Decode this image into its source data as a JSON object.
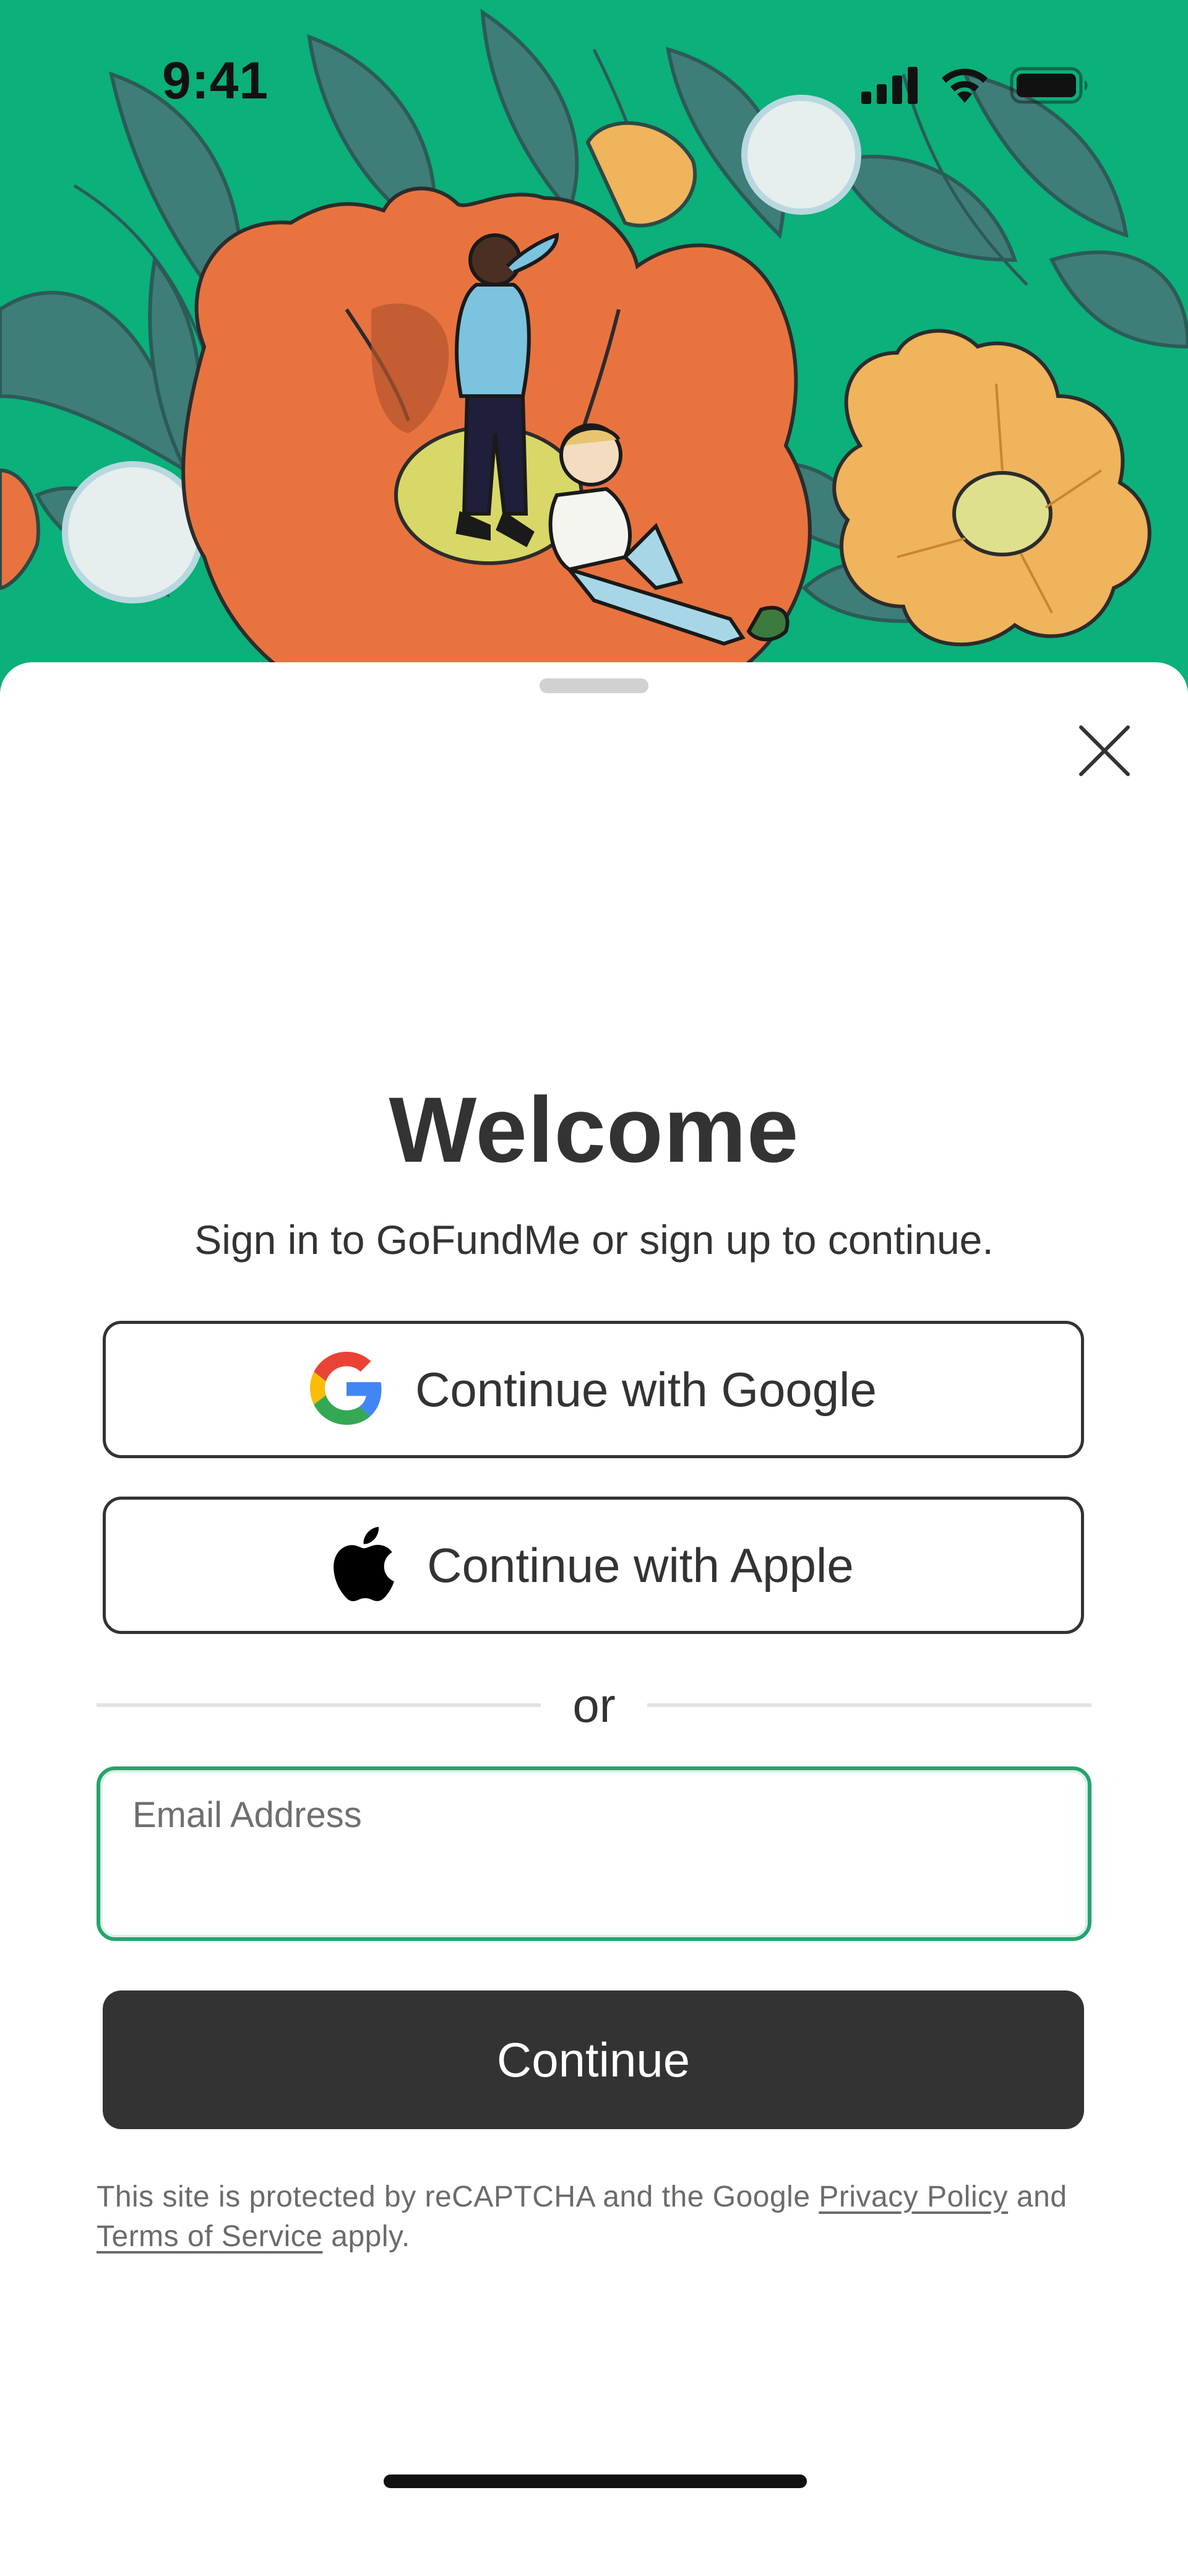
{
  "status_bar": {
    "time": "9:41",
    "icons": [
      "signal-icon",
      "wifi-icon",
      "battery-icon"
    ]
  },
  "hero": {
    "description_icons": [
      "flower-illustration"
    ],
    "colors": {
      "background": "#0bb07a",
      "big_flower": "#e8733f",
      "yellow_flower": "#efb45c",
      "leaves": "#3f7d78"
    }
  },
  "sheet": {
    "close_icon": "close-icon",
    "title": "Welcome",
    "subtitle": "Sign in to GoFundMe or sign up to continue.",
    "google_button": {
      "icon": "google-logo-icon",
      "label": "Continue with Google"
    },
    "apple_button": {
      "icon": "apple-logo-icon",
      "label": "Continue with Apple"
    },
    "divider_label": "or",
    "email_field": {
      "label": "Email Address",
      "value": ""
    },
    "continue_button": {
      "label": "Continue"
    },
    "legal": {
      "text_before": "This site is protected by reCAPTCHA and the Google ",
      "privacy_link": "Privacy Policy",
      "text_middle": " and ",
      "terms_link": "Terms of Service",
      "text_after": " apply."
    }
  },
  "colors": {
    "accent_green": "#24a36b",
    "primary_button": "#333333",
    "text": "#333333",
    "muted_text": "#6b6b6b"
  }
}
